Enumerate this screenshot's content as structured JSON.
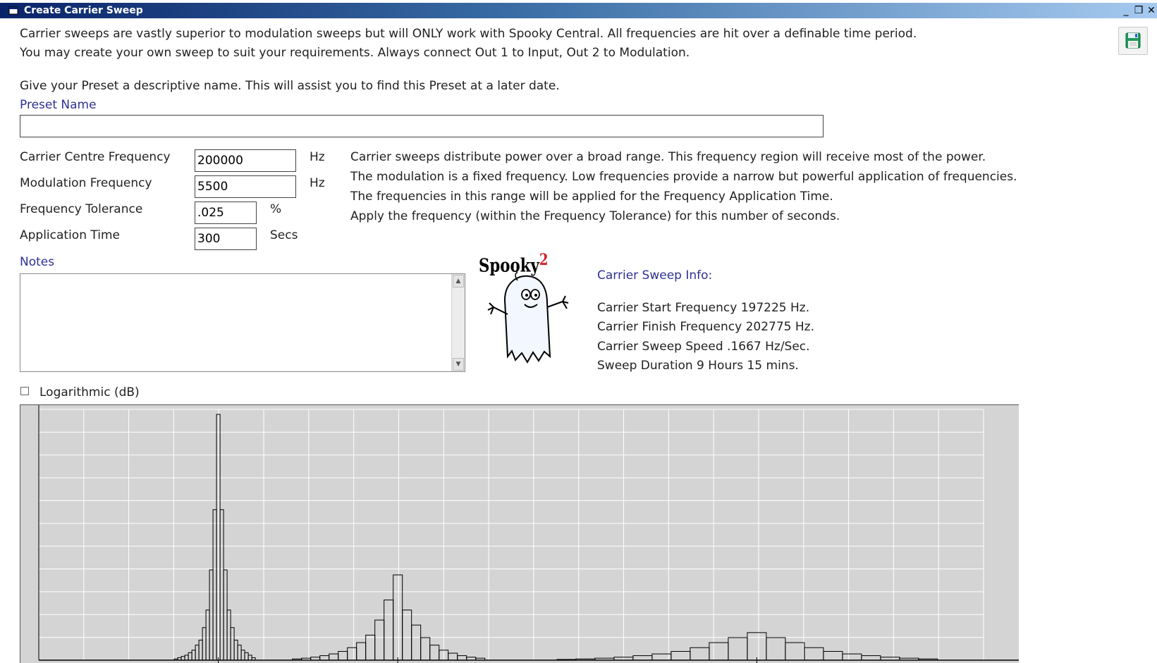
{
  "window": {
    "title": "Create Carrier Sweep"
  },
  "intro": {
    "line1": "Carrier sweeps are vastly superior to modulation sweeps but will ONLY work with Spooky Central. All frequencies are hit over a definable time period.",
    "line2": "You may create your own sweep to suit your requirements. Always connect Out 1 to Input, Out 2 to Modulation.",
    "line3": "Give your Preset a descriptive name. This will assist you to find this Preset at a later date."
  },
  "preset": {
    "label": "Preset Name",
    "value": ""
  },
  "fields": {
    "carrier_centre": {
      "label": "Carrier Centre Frequency",
      "value": "200000",
      "unit": "Hz"
    },
    "modulation": {
      "label": "Modulation Frequency",
      "value": "5500",
      "unit": "Hz"
    },
    "tolerance": {
      "label": "Frequency Tolerance",
      "value": ".025",
      "unit": "%"
    },
    "app_time": {
      "label": "Application Time",
      "value": "300",
      "unit": "Secs"
    }
  },
  "help": {
    "line1": "Carrier sweeps distribute power over a broad range. This frequency region will receive most of the power.",
    "line2": "The modulation is a fixed frequency. Low frequencies provide a narrow but powerful application of frequencies.",
    "line3": "The frequencies in this range will be applied for the Frequency Application Time.",
    "line4": "Apply the frequency (within the Frequency Tolerance) for this number of seconds."
  },
  "notes": {
    "label": "Notes",
    "value": ""
  },
  "logo": {
    "text": "Spooky",
    "superscript": "2"
  },
  "info": {
    "heading": "Carrier Sweep Info:",
    "start": "Carrier Start Frequency 197225 Hz.",
    "finish": "Carrier Finish Frequency 202775 Hz.",
    "speed": "Carrier Sweep Speed .1667 Hz/Sec.",
    "duration": "Sweep Duration 9 Hours 15 mins."
  },
  "logarithmic": {
    "label": "Logarithmic (dB)",
    "checked": false
  },
  "colors": {
    "chart_bg": "#d4d4d4",
    "grid": "#ffffff",
    "bar_stroke": "#000000",
    "bar_fill": "#ffffff"
  },
  "chart_data": {
    "type": "bar",
    "title": "",
    "grid": true,
    "series": [
      {
        "values": [
          0.005,
          0.01,
          0.015,
          0.02,
          0.03,
          0.04,
          0.06,
          0.08,
          0.13,
          0.2,
          0.36,
          0.6,
          0.98,
          0.6,
          0.36,
          0.2,
          0.13,
          0.08,
          0.06,
          0.04,
          0.03,
          0.02,
          0.01
        ]
      },
      {
        "values": [
          0.005,
          0.008,
          0.012,
          0.018,
          0.025,
          0.035,
          0.05,
          0.07,
          0.1,
          0.16,
          0.24,
          0.34,
          0.2,
          0.14,
          0.09,
          0.06,
          0.04,
          0.028,
          0.018,
          0.012,
          0.008
        ]
      },
      {
        "values": [
          0.003,
          0.005,
          0.008,
          0.012,
          0.018,
          0.025,
          0.035,
          0.05,
          0.07,
          0.09,
          0.11,
          0.09,
          0.07,
          0.05,
          0.035,
          0.025,
          0.018,
          0.012,
          0.008,
          0.005
        ]
      }
    ]
  }
}
